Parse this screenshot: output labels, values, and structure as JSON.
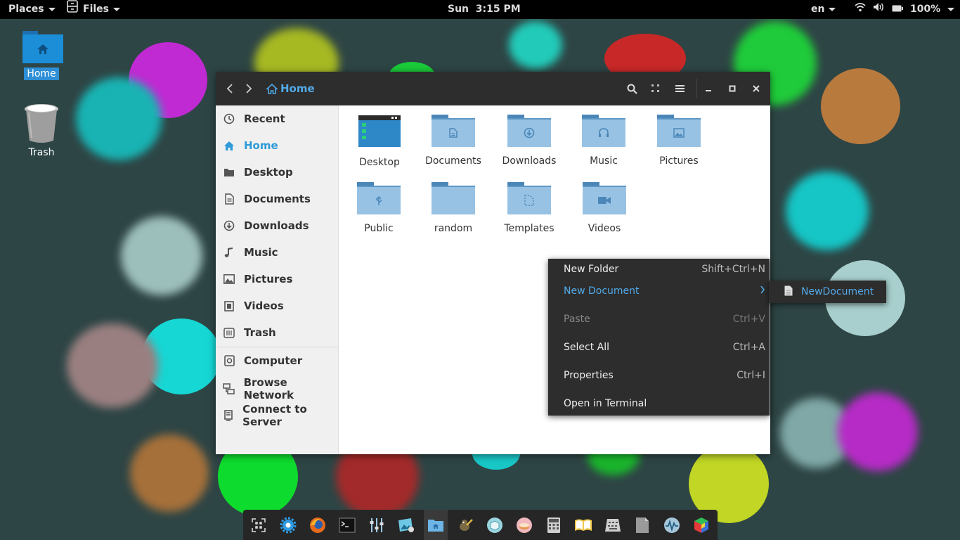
{
  "topbar": {
    "places": "Places",
    "files": "Files",
    "clock": "Sun  3:15 PM",
    "language": "en",
    "battery": "100%"
  },
  "desktop": {
    "icons": [
      {
        "label": "Home",
        "icon": "folder-home-icon",
        "selected": true
      },
      {
        "label": "Trash",
        "icon": "trash-icon",
        "selected": false
      }
    ]
  },
  "window": {
    "path": "Home",
    "colors": {
      "accent": "#52a9e8",
      "headerbar": "#2d2d2d",
      "sidebar": "#f0f0f0",
      "folder": "#98c2e4"
    }
  },
  "sidebar": {
    "items": [
      {
        "label": "Recent",
        "icon": "clock-icon"
      },
      {
        "label": "Home",
        "icon": "home-icon",
        "active": true
      },
      {
        "label": "Desktop",
        "icon": "desktop-folder-icon"
      },
      {
        "label": "Documents",
        "icon": "document-icon"
      },
      {
        "label": "Downloads",
        "icon": "download-icon"
      },
      {
        "label": "Music",
        "icon": "music-note-icon"
      },
      {
        "label": "Pictures",
        "icon": "picture-icon"
      },
      {
        "label": "Videos",
        "icon": "film-icon"
      },
      {
        "label": "Trash",
        "icon": "trash-icon"
      },
      {
        "label": "Computer",
        "icon": "computer-icon"
      },
      {
        "label": "Browse Network",
        "icon": "network-icon"
      },
      {
        "label": "Connect to Server",
        "icon": "server-icon"
      }
    ]
  },
  "files": [
    {
      "name": "Desktop",
      "icon": "desktop-folder-icon"
    },
    {
      "name": "Documents",
      "icon": "documents-folder-icon"
    },
    {
      "name": "Downloads",
      "icon": "downloads-folder-icon"
    },
    {
      "name": "Music",
      "icon": "music-folder-icon"
    },
    {
      "name": "Pictures",
      "icon": "pictures-folder-icon"
    },
    {
      "name": "Public",
      "icon": "public-folder-icon"
    },
    {
      "name": "random",
      "icon": "folder-icon"
    },
    {
      "name": "Templates",
      "icon": "templates-folder-icon"
    },
    {
      "name": "Videos",
      "icon": "videos-folder-icon"
    }
  ],
  "context_menu": {
    "items": [
      {
        "label": "New Folder",
        "accel": "Shift+Ctrl+N"
      },
      {
        "label": "New Document",
        "accel": "",
        "submenu": true,
        "highlighted": true
      },
      {
        "label": "Paste",
        "accel": "Ctrl+V",
        "disabled": true
      },
      {
        "label": "Select All",
        "accel": "Ctrl+A"
      },
      {
        "label": "Properties",
        "accel": "Ctrl+I"
      },
      {
        "label": "Open in Terminal",
        "accel": ""
      }
    ],
    "submenu": {
      "label": "NewDocument",
      "icon": "text-document-icon"
    }
  },
  "dock": {
    "items": [
      "app-grid-icon",
      "settings-gear-icon",
      "firefox-icon",
      "terminal-icon",
      "tweak-tool-icon",
      "image-viewer-icon",
      "files-icon",
      "gimp-icon",
      "software-icon",
      "cake-icon",
      "calculator-icon",
      "dictionary-icon",
      "keyboard-icon",
      "document-viewer-icon",
      "system-monitor-icon",
      "cube-icon"
    ]
  }
}
